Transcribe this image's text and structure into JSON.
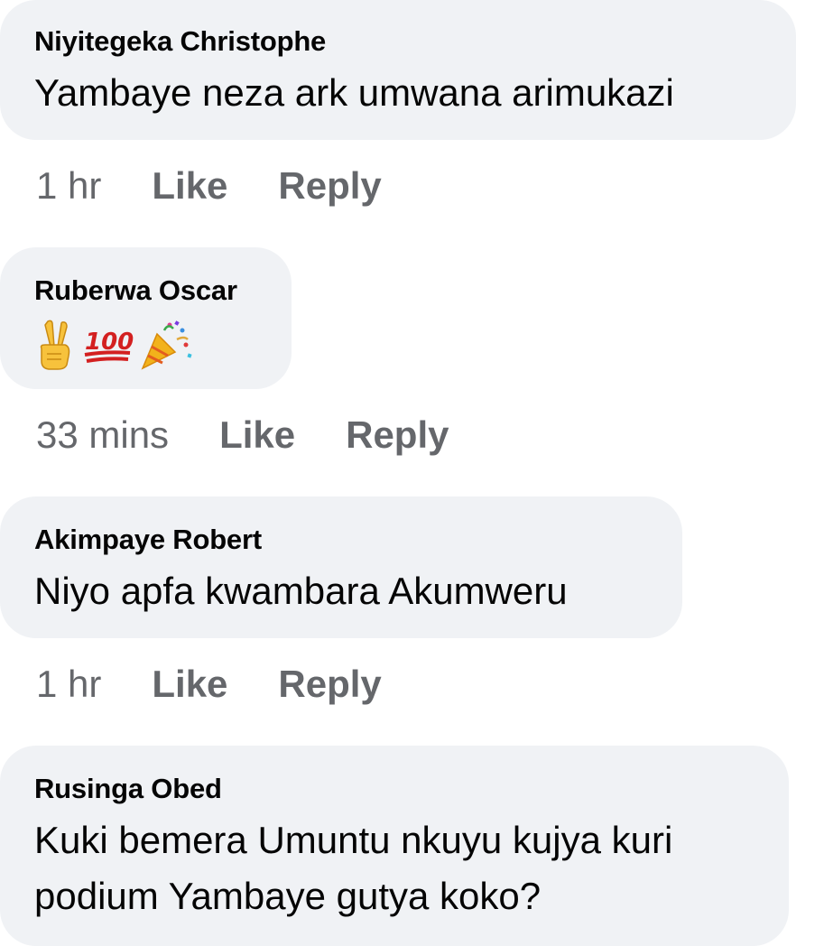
{
  "comments": [
    {
      "author": "Niyitegeka Christophe",
      "text": "Yambaye neza ark umwana arimukazi",
      "time": "1 hr",
      "like_label": "Like",
      "reply_label": "Reply"
    },
    {
      "author": "Ruberwa Oscar",
      "emojis": [
        "victory-hand-icon",
        "hundred-points-icon",
        "party-popper-icon"
      ],
      "time": "33 mins",
      "like_label": "Like",
      "reply_label": "Reply"
    },
    {
      "author": "Akimpaye Robert",
      "text": "Niyo apfa kwambara Akumweru",
      "time": "1 hr",
      "like_label": "Like",
      "reply_label": "Reply"
    },
    {
      "author": "Rusinga Obed",
      "text_line1": "Kuki bemera Umuntu nkuyu kujya kuri",
      "text_line2": "podium Yambaye gutya koko?"
    }
  ],
  "colors": {
    "bubble_bg": "#f0f2f5",
    "author": "#050505",
    "meta": "#65676b"
  }
}
